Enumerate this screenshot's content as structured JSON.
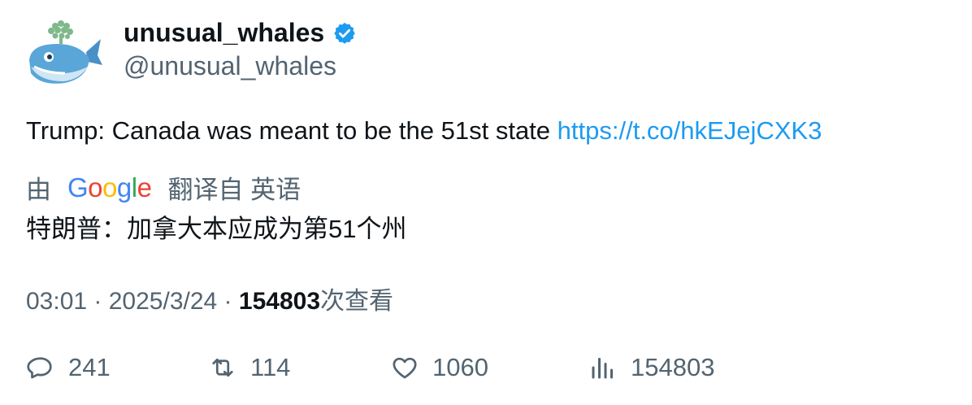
{
  "author": {
    "display_name": "unusual_whales",
    "handle": "@unusual_whales",
    "verified": true,
    "avatar_icon": "whale-avatar-icon"
  },
  "tweet": {
    "text": "Trump: Canada was meant to be the 51st state ",
    "link": "https://t.co/hkEJejCXK3"
  },
  "translation": {
    "prefix": "由",
    "provider": "Google",
    "suffix": "翻译自 英语",
    "text": "特朗普：加拿大本应成为第51个州"
  },
  "meta": {
    "time": "03:01",
    "separator": " · ",
    "date": "2025/3/24",
    "views": "154803",
    "views_label": "次查看"
  },
  "actions": {
    "replies": "241",
    "retweets": "114",
    "likes": "1060",
    "views": "154803"
  },
  "colors": {
    "link": "#1d9bf0",
    "muted": "#536471",
    "text": "#0f1419",
    "verified": "#1d9bf0"
  }
}
